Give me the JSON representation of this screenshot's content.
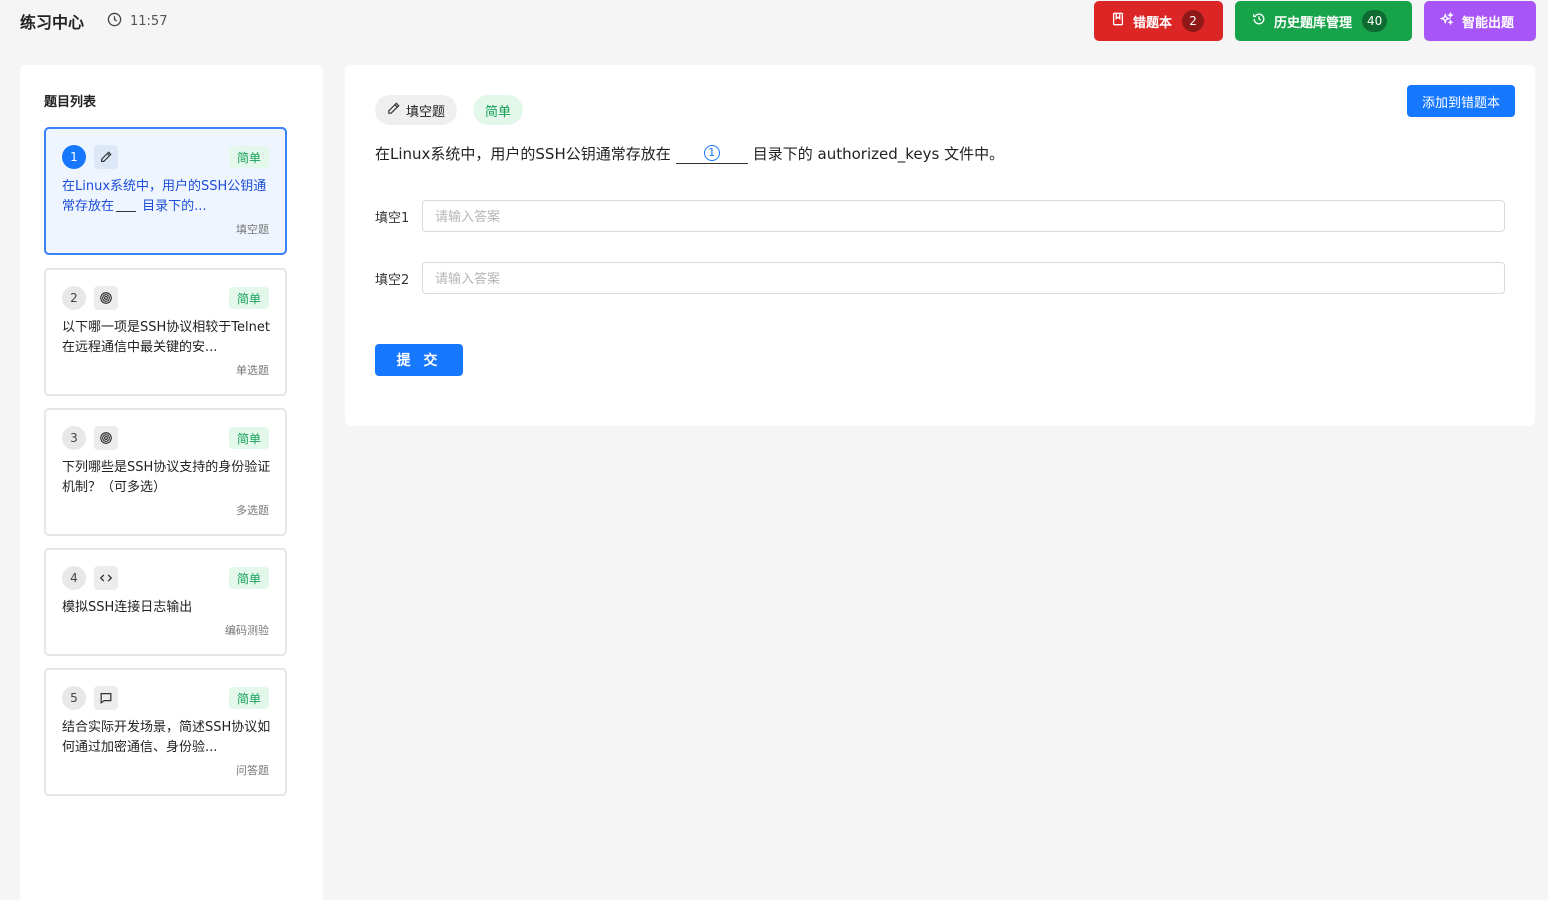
{
  "header": {
    "title": "练习中心",
    "time": "11:57",
    "wrong_book": {
      "label": "错题本",
      "count": "2"
    },
    "history": {
      "label": "历史题库管理",
      "count": "40"
    },
    "ai": {
      "label": "智能出题"
    }
  },
  "sidebar": {
    "title": "题目列表",
    "items": [
      {
        "num": "1",
        "icon": "pencil-icon",
        "difficulty": "简单",
        "text_before": "在Linux系统中，用户的SSH公钥通常存放在",
        "text_after": "目录下的...",
        "type": "填空题",
        "active": true
      },
      {
        "num": "2",
        "icon": "target-icon",
        "difficulty": "简单",
        "text": "以下哪一项是SSH协议相较于Telnet在远程通信中最关键的安...",
        "type": "单选题"
      },
      {
        "num": "3",
        "icon": "target-icon",
        "difficulty": "简单",
        "text": "下列哪些是SSH协议支持的身份验证机制？（可多选）",
        "type": "多选题"
      },
      {
        "num": "4",
        "icon": "code-icon",
        "difficulty": "简单",
        "text": "模拟SSH连接日志输出",
        "type": "编码测验"
      },
      {
        "num": "5",
        "icon": "chat-icon",
        "difficulty": "简单",
        "text": "结合实际开发场景，简述SSH协议如何通过加密通信、身份验...",
        "type": "问答题"
      }
    ]
  },
  "main": {
    "type_tag": "填空题",
    "difficulty_tag": "简单",
    "add_button": "添加到错题本",
    "question_before": "在Linux系统中，用户的SSH公钥通常存放在",
    "blank_marker": "1",
    "question_after": "目录下的 authorized_keys 文件中。",
    "fields": [
      {
        "label": "填空1",
        "placeholder": "请输入答案",
        "value": ""
      },
      {
        "label": "填空2",
        "placeholder": "请输入答案",
        "value": ""
      }
    ],
    "submit": "提 交"
  },
  "colors": {
    "primary": "#1677ff",
    "danger": "#dc2626",
    "success": "#16a34a",
    "purple": "#a855f7",
    "easy_bg": "#e3f8ea",
    "easy_text": "#15a05a"
  }
}
